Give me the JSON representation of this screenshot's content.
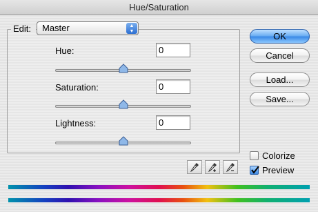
{
  "window": {
    "title": "Hue/Saturation"
  },
  "edit": {
    "label": "Edit:",
    "selected": "Master"
  },
  "fields": {
    "hue": {
      "label": "Hue:",
      "value": "0"
    },
    "saturation": {
      "label": "Saturation:",
      "value": "0"
    },
    "lightness": {
      "label": "Lightness:",
      "value": "0"
    }
  },
  "sliders": {
    "hue_level": 0.5,
    "saturation_level": 0.5,
    "lightness_level": 0.5
  },
  "buttons": {
    "ok": "OK",
    "cancel": "Cancel",
    "load": "Load...",
    "save": "Save..."
  },
  "options": {
    "colorize": {
      "label": "Colorize",
      "checked": false
    },
    "preview": {
      "label": "Preview",
      "checked": true
    }
  },
  "icons": [
    "eyedropper-icon",
    "eyedropper-plus-icon",
    "eyedropper-minus-icon"
  ],
  "colors": {
    "default_button": "#3b8ae6",
    "accent": "#2d6fd2"
  }
}
